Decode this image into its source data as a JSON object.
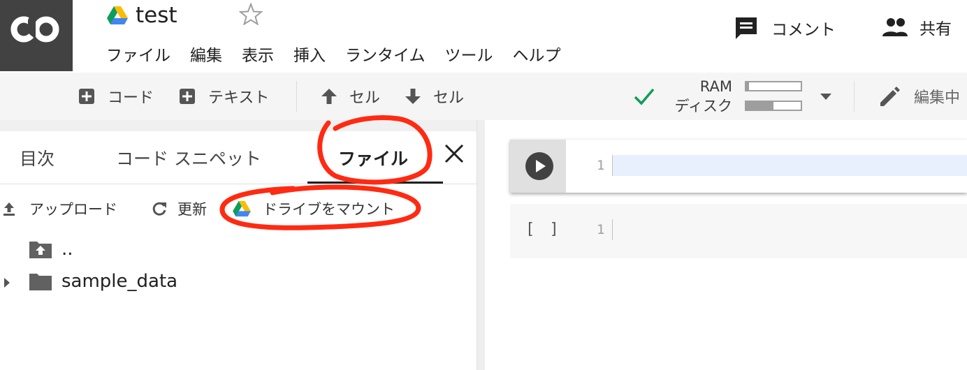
{
  "app": {
    "logo_text": "CO",
    "title": "test"
  },
  "menu": [
    "ファイル",
    "編集",
    "表示",
    "挿入",
    "ランタイム",
    "ツール",
    "ヘルプ"
  ],
  "header_actions": {
    "comment": "コメント",
    "share": "共有"
  },
  "toolbar": {
    "add_code": "コード",
    "add_text": "テキスト",
    "cell_up": "セル",
    "cell_down": "セル",
    "ram_label": "RAM",
    "disk_label": "ディスク",
    "ram_usage": 0.05,
    "disk_usage": 0.5,
    "edit_mode": "編集中"
  },
  "side_panel": {
    "tabs": [
      "目次",
      "コード スニペット",
      "ファイル"
    ],
    "active_tab": "ファイル",
    "actions": {
      "upload": "アップロード",
      "refresh": "更新",
      "mount_drive": "ドライブをマウント"
    },
    "tree": [
      {
        "name": "..",
        "type": "parent-folder"
      },
      {
        "name": "sample_data",
        "type": "folder"
      }
    ]
  },
  "notebook": {
    "cells": [
      {
        "line_number": "1",
        "state": "focused"
      },
      {
        "line_number": "1",
        "state": "idle",
        "exec_label": "[ ]"
      }
    ]
  },
  "colors": {
    "annotation_red": "#ff2a12",
    "check_green": "#0f9d58",
    "logo_bg": "#424242"
  }
}
